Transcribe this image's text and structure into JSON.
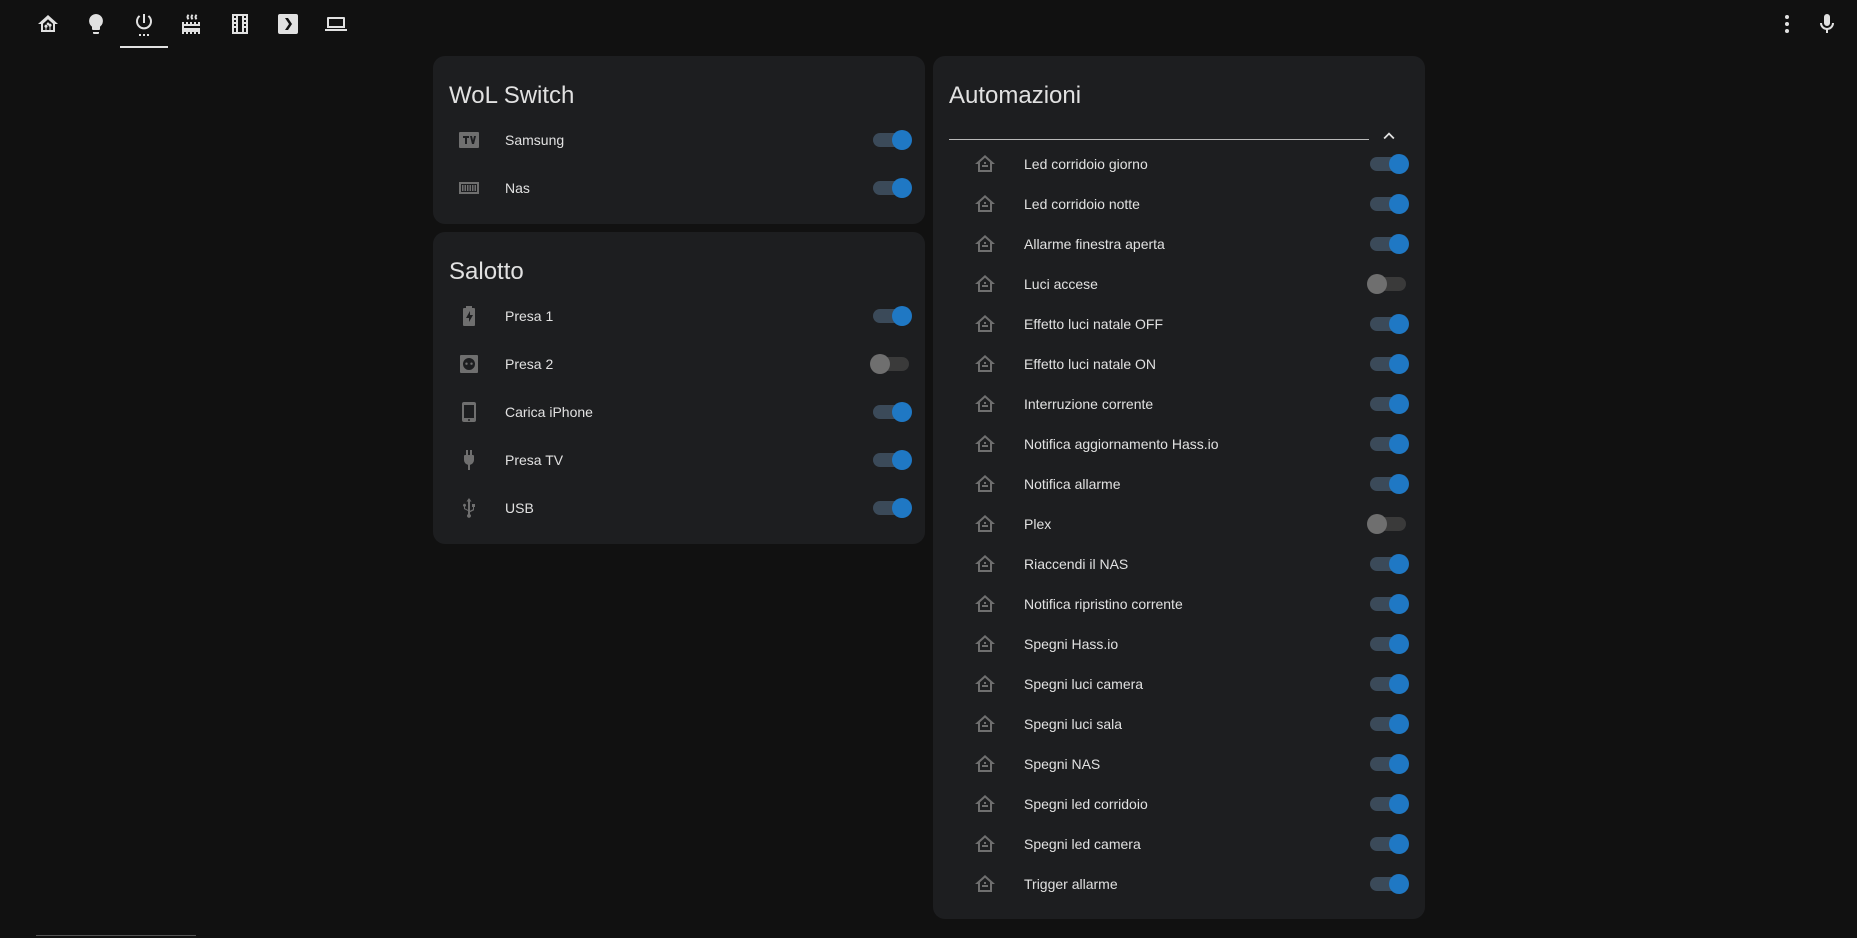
{
  "colors": {
    "background": "#111111",
    "card": "#1d1e20",
    "toggle_on": "#1f78c4",
    "toggle_off": "#6f6f6f",
    "entity_icon": "#44739e"
  },
  "toolbar": {
    "tabs": [
      {
        "icon": "home-assistant-icon"
      },
      {
        "icon": "lightbulb-icon"
      },
      {
        "icon": "power-settings-icon",
        "active": true
      },
      {
        "icon": "radiator-icon"
      },
      {
        "icon": "film-icon"
      },
      {
        "icon": "plex-icon"
      },
      {
        "icon": "laptop-icon"
      }
    ],
    "menu_icon": "dots-vertical-icon",
    "voice_icon": "microphone-icon"
  },
  "wol": {
    "title": "WoL Switch",
    "items": [
      {
        "label": "Samsung",
        "icon": "tv-icon",
        "state": "on"
      },
      {
        "label": "Nas",
        "icon": "nas-icon",
        "state": "on"
      }
    ]
  },
  "salotto": {
    "title": "Salotto",
    "items": [
      {
        "label": "Presa 1",
        "icon": "battery-charging-icon",
        "state": "on"
      },
      {
        "label": "Presa 2",
        "icon": "power-socket-icon",
        "state": "off"
      },
      {
        "label": "Carica iPhone",
        "icon": "cellphone-icon",
        "state": "on"
      },
      {
        "label": "Presa TV",
        "icon": "power-plug-icon",
        "state": "on"
      },
      {
        "label": "USB",
        "icon": "usb-icon",
        "state": "on"
      }
    ]
  },
  "automazioni": {
    "title": "Automazioni",
    "collapse_icon": "chevron-up-icon",
    "items": [
      {
        "label": "Led corridoio giorno",
        "state": "on"
      },
      {
        "label": "Led corridoio notte",
        "state": "on"
      },
      {
        "label": "Allarme finestra aperta",
        "state": "on"
      },
      {
        "label": "Luci accese",
        "state": "off"
      },
      {
        "label": "Effetto luci natale OFF",
        "state": "on"
      },
      {
        "label": "Effetto luci natale ON",
        "state": "on"
      },
      {
        "label": "Interruzione corrente",
        "state": "on"
      },
      {
        "label": "Notifica aggiornamento Hass.io",
        "state": "on"
      },
      {
        "label": "Notifica allarme",
        "state": "on"
      },
      {
        "label": "Plex",
        "state": "off"
      },
      {
        "label": "Riaccendi il NAS",
        "state": "on"
      },
      {
        "label": "Notifica ripristino corrente",
        "state": "on"
      },
      {
        "label": "Spegni Hass.io",
        "state": "on"
      },
      {
        "label": "Spegni luci camera",
        "state": "on"
      },
      {
        "label": "Spegni luci sala",
        "state": "on"
      },
      {
        "label": "Spegni NAS",
        "state": "on"
      },
      {
        "label": "Spegni led corridoio",
        "state": "on"
      },
      {
        "label": "Spegni led camera",
        "state": "on"
      },
      {
        "label": "Trigger allarme",
        "state": "on"
      }
    ]
  }
}
